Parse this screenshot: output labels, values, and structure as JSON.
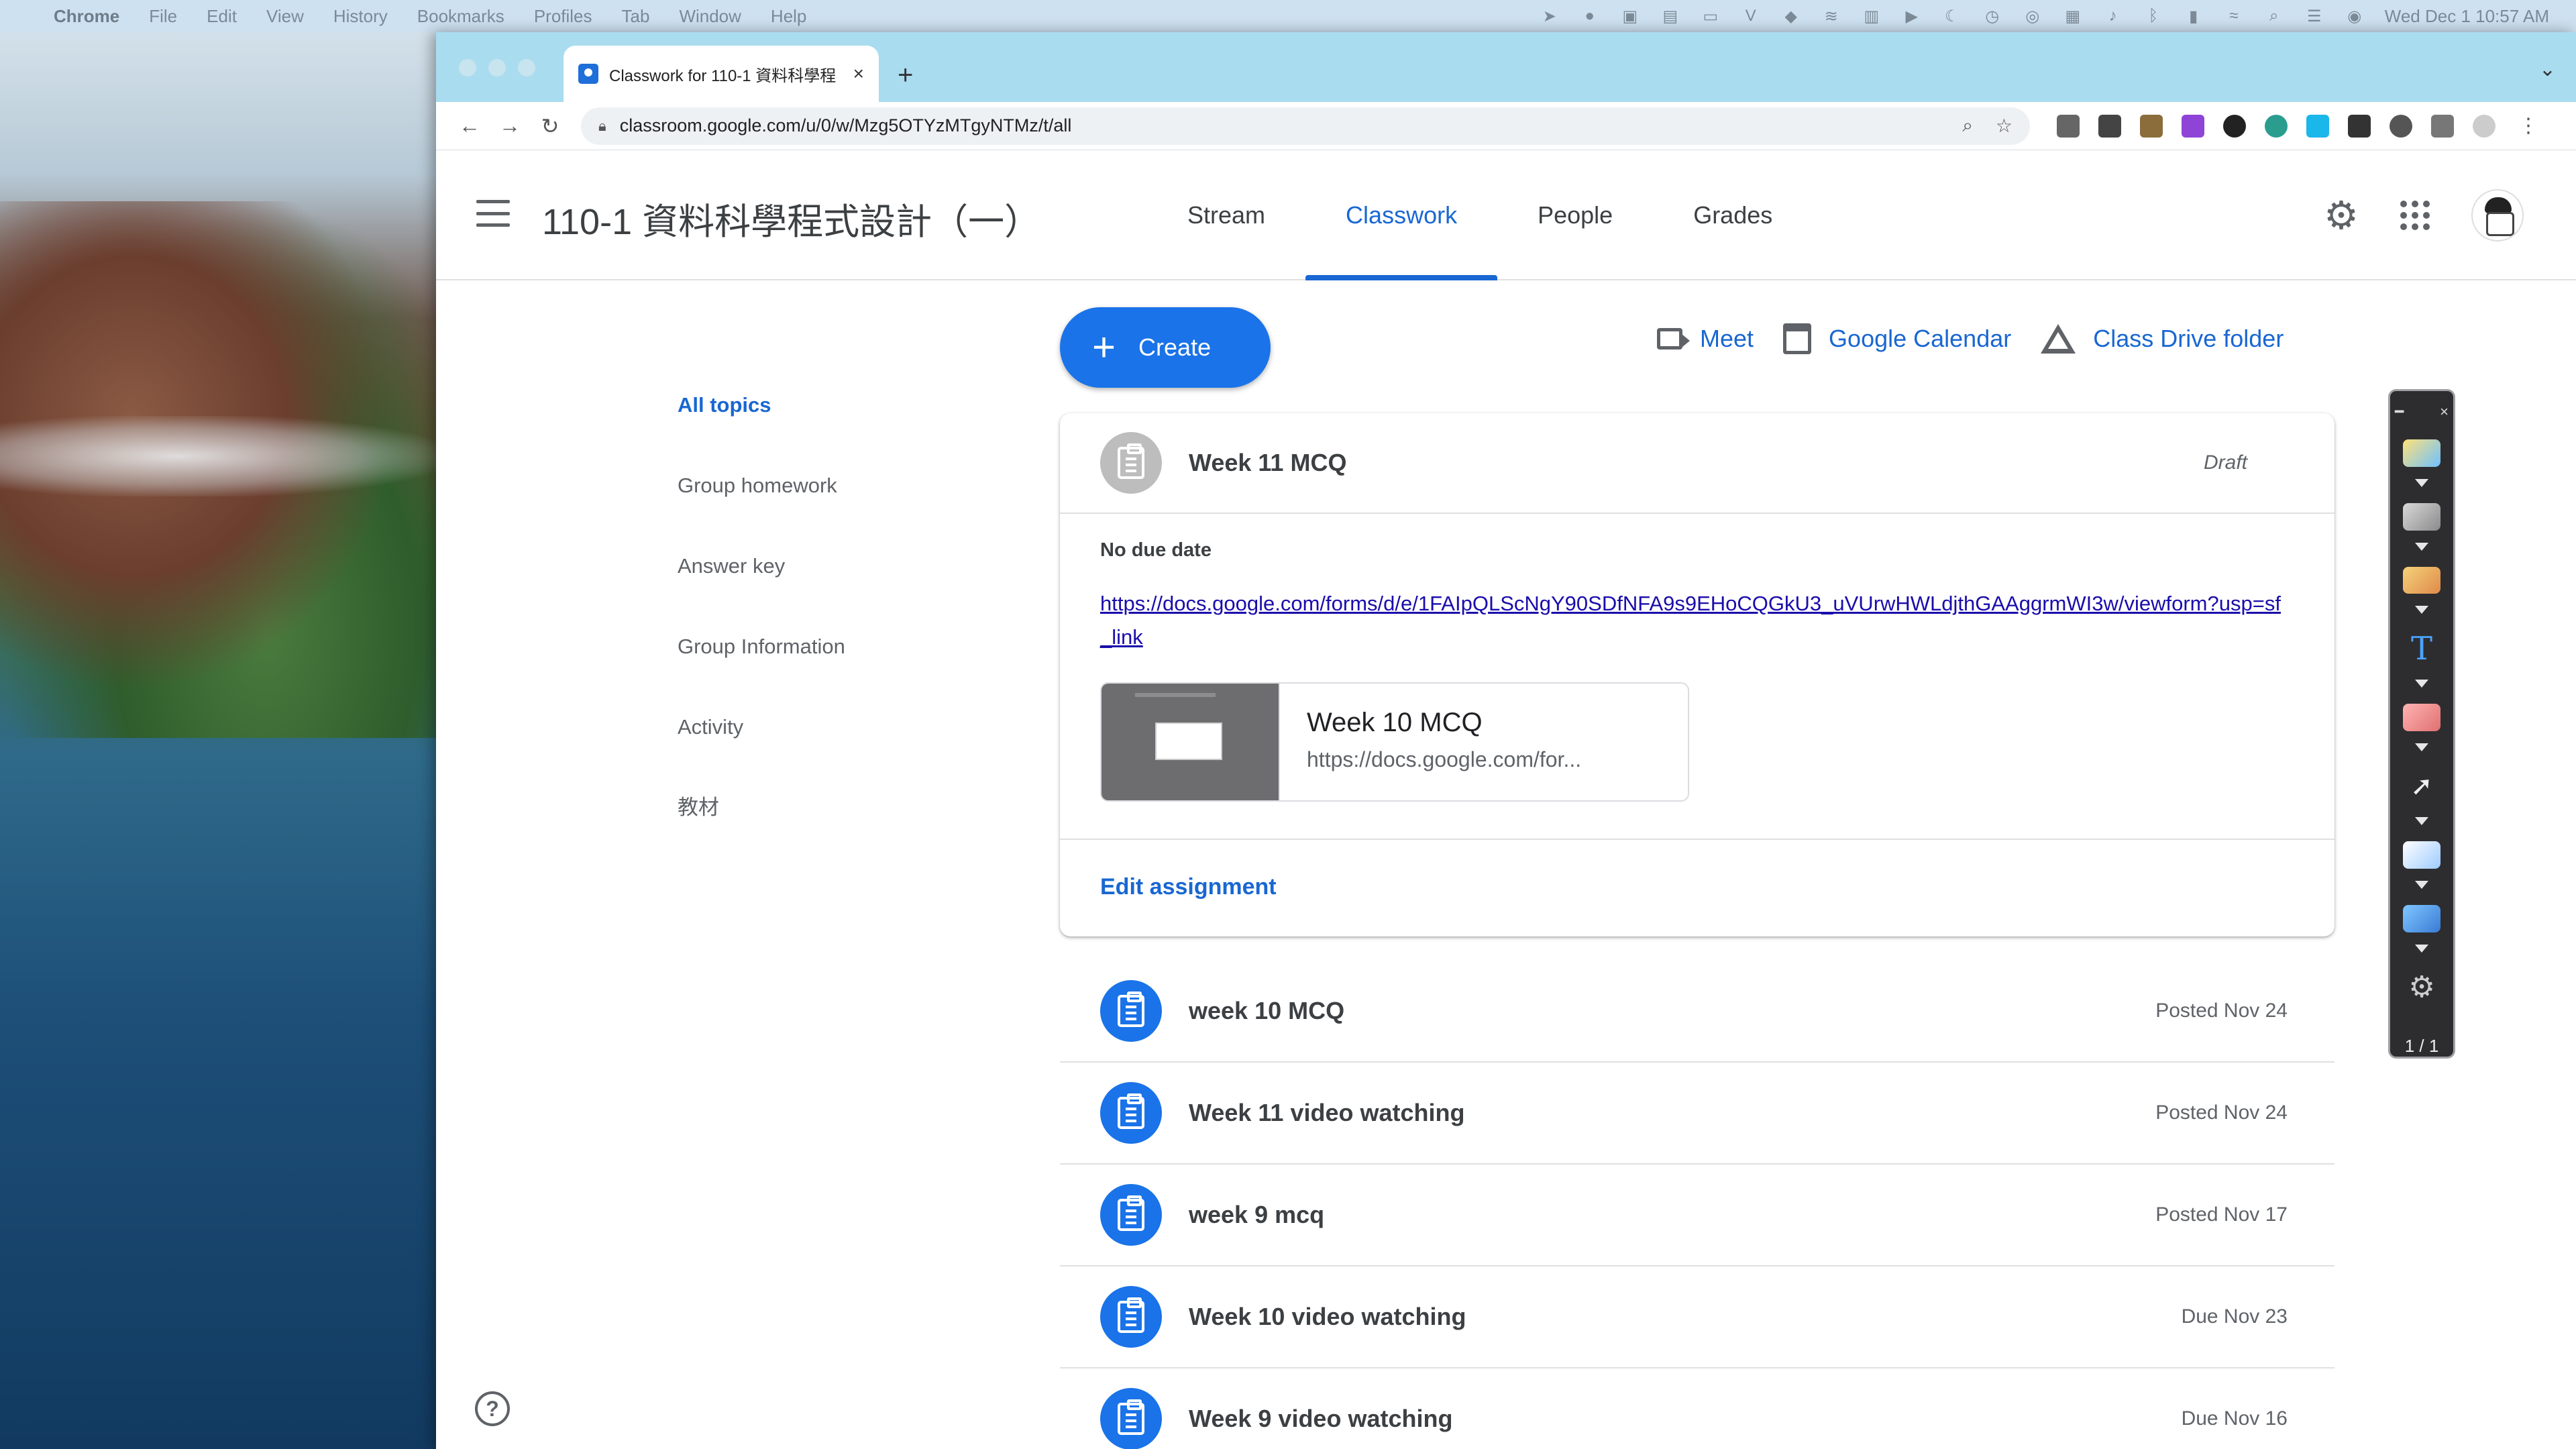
{
  "menubar": {
    "app": "Chrome",
    "items": [
      "File",
      "Edit",
      "View",
      "History",
      "Bookmarks",
      "Profiles",
      "Tab",
      "Window",
      "Help"
    ],
    "clock": "Wed Dec 1  10:57 AM"
  },
  "browser": {
    "tab_title": "Classwork for 110-1 資料科學程",
    "tab_close": "×",
    "new_tab": "+",
    "url": "classroom.google.com/u/0/w/Mzg5OTYzMTgyNTMz/t/all",
    "nav_back": "←",
    "nav_forward": "→",
    "nav_reload": "↻"
  },
  "classroom": {
    "course_title": "110-1 資料科學程式設計（一）",
    "nav_tabs": [
      "Stream",
      "Classwork",
      "People",
      "Grades"
    ],
    "active_tab": "Classwork",
    "create_label": "Create",
    "quick_links": {
      "meet": "Meet",
      "calendar": "Google Calendar",
      "drive": "Class Drive folder"
    },
    "topics": [
      "All topics",
      "Group homework",
      "Answer key",
      "Group Information",
      "Activity",
      "教材"
    ],
    "expanded": {
      "title": "Week 11 MCQ",
      "status": "Draft",
      "due": "No due date",
      "link": "https://docs.google.com/forms/d/e/1FAIpQLScNgY90SDfNFA9s9EHoCQGkU3_uVUrwHWLdjthGAAggrmWI3w/viewform?usp=sf_link",
      "attachment_title": "Week 10 MCQ",
      "attachment_url": "https://docs.google.com/for...",
      "edit_label": "Edit assignment"
    },
    "items": [
      {
        "title": "week 10 MCQ",
        "date": "Posted Nov 24"
      },
      {
        "title": "Week 11 video watching",
        "date": "Posted Nov 24"
      },
      {
        "title": "week 9 mcq",
        "date": "Posted Nov 17"
      },
      {
        "title": "Week 10 video watching",
        "date": "Due Nov 23"
      },
      {
        "title": "Week 9 video watching",
        "date": "Due Nov 16"
      }
    ]
  },
  "draw_toolbar": {
    "page_indicator": "1 / 1"
  },
  "colors": {
    "accent": "#1967d2",
    "create_button": "#1a73e8",
    "tabstrip": "#a9dcef"
  }
}
